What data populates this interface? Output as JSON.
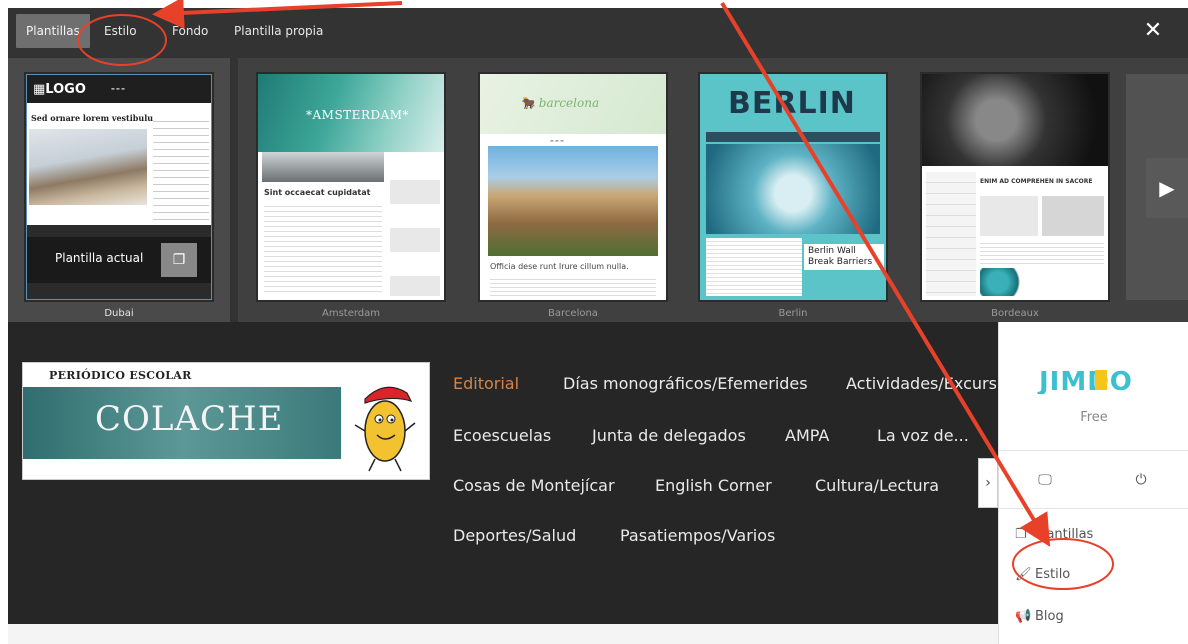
{
  "chooser": {
    "tabs": [
      {
        "label": "Plantillas",
        "active": true
      },
      {
        "label": "Estilo",
        "active": false
      },
      {
        "label": "Fondo",
        "active": false
      },
      {
        "label": "Plantilla propia",
        "active": false
      }
    ],
    "close_icon": "close-icon",
    "current_template": {
      "name": "Dubai",
      "overlay_label": "Plantilla actual",
      "copy_icon": "copy-icon",
      "thumb_texts": {
        "logo": "LOGO",
        "heading": "Sed ornare lorem vestibulum"
      }
    },
    "templates": [
      {
        "name": "Amsterdam",
        "thumb_brand": "*AMSTERDAM*",
        "thumb_heading": "Sint occaecat cupidatat"
      },
      {
        "name": "Barcelona",
        "thumb_brand": "barcelona",
        "thumb_caption": "Officia dese runt Irure cillum nulla."
      },
      {
        "name": "Berlin",
        "thumb_brand": "BERLIN",
        "thumb_caption": "Berlin Wall Break Barriers"
      },
      {
        "name": "Bordeaux",
        "thumb_heading": "ENIM AD COMPREHEN IN SACORE"
      }
    ],
    "next_icon": "chevron-right-icon"
  },
  "site": {
    "banner": {
      "top": "PERIÓDICO ESCOLAR",
      "title": "COLACHE"
    },
    "menu": [
      {
        "label": "Editorial",
        "active": true
      },
      {
        "label": "Días monográficos/Efemerides"
      },
      {
        "label": "Actividades/Excursi"
      },
      {
        "label": "Ecoescuelas"
      },
      {
        "label": "Junta de delegados"
      },
      {
        "label": "AMPA"
      },
      {
        "label": "La voz de..."
      },
      {
        "label": "Cosas de Montejícar"
      },
      {
        "label": "English Corner"
      },
      {
        "label": "Cultura/Lectura"
      },
      {
        "label": "Deportes/Salud"
      },
      {
        "label": "Pasatiempos/Varios"
      }
    ]
  },
  "jimdo": {
    "logo": "JIMDO",
    "plan": "Free",
    "monitor_icon": "monitor-icon",
    "power_icon": "power-icon",
    "items": [
      {
        "label": "Plantillas",
        "icon": "templates-icon"
      },
      {
        "label": "Estilo",
        "icon": "paint-roller-icon"
      },
      {
        "label": "Blog",
        "icon": "megaphone-icon"
      }
    ],
    "collapse_icon": "chevron-right-icon"
  },
  "colors": {
    "accent_menu": "#d4864a",
    "annotation": "#e8412a",
    "jimdo_teal": "#3cc0d0",
    "jimdo_yellow": "#f5c518"
  }
}
